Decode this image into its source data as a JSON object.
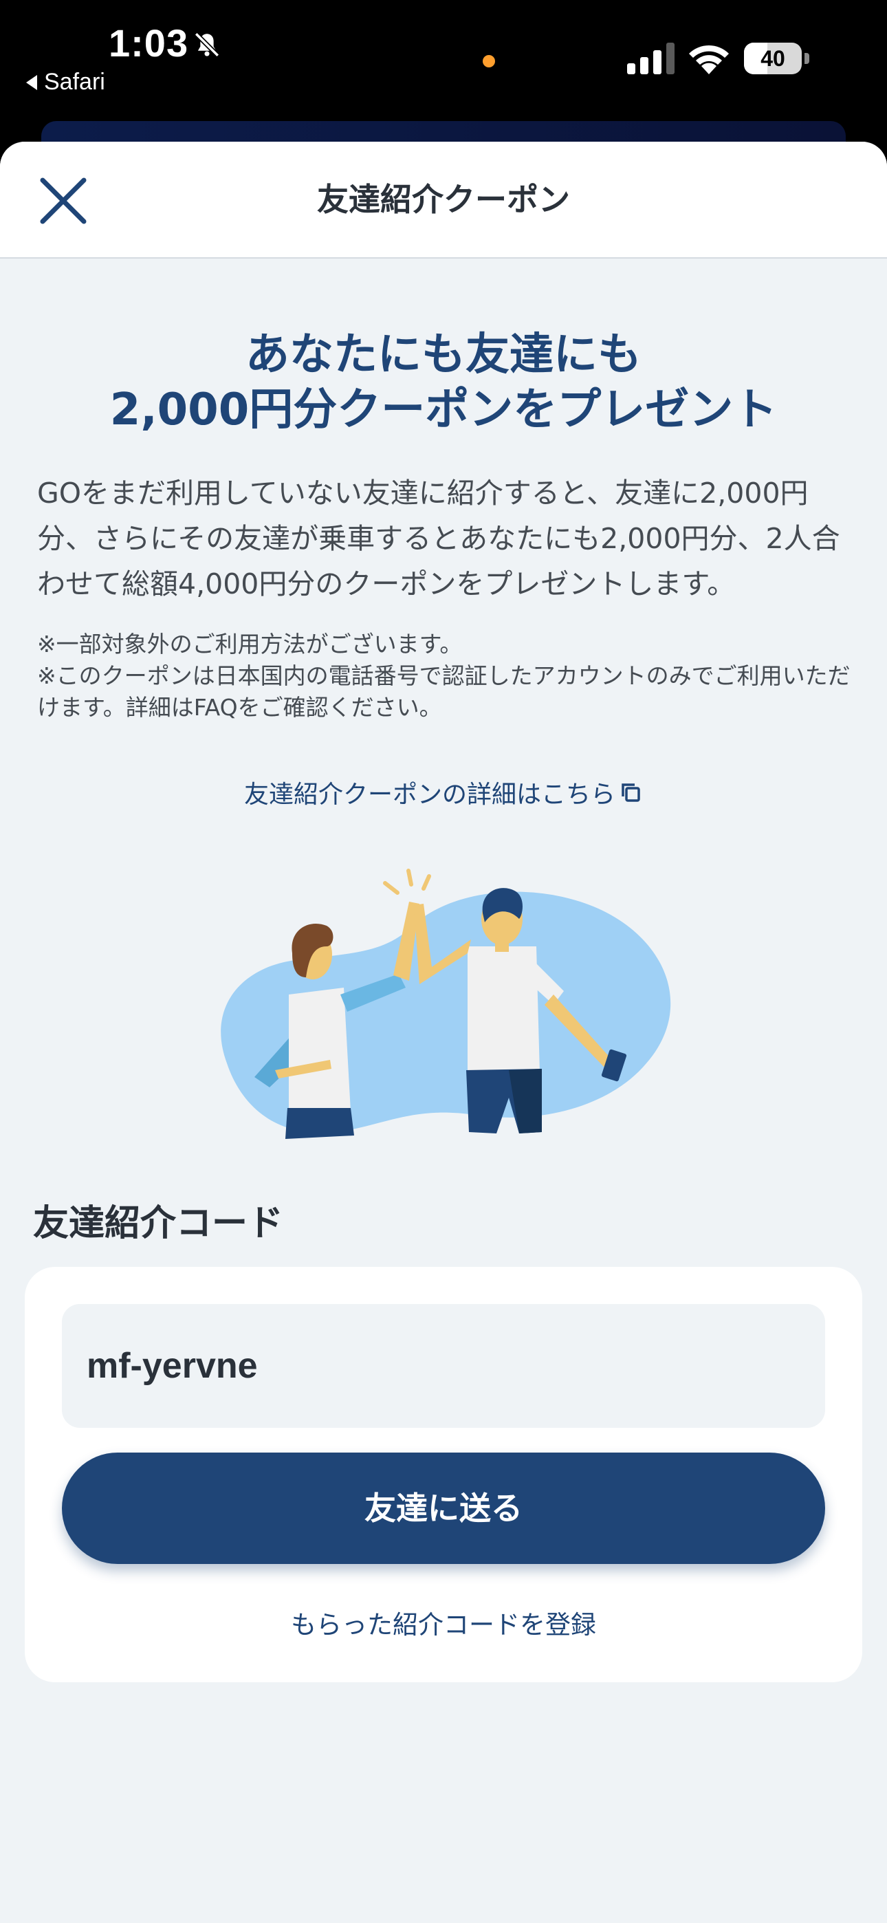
{
  "status_bar": {
    "time": "1:03",
    "back_app": "Safari",
    "battery": "40",
    "battery_level": 0.4
  },
  "header": {
    "title": "友達紹介クーポン"
  },
  "hero": {
    "headline_line1": "あなたにも友達にも",
    "headline_line2": "2,000円分クーポンをプレゼント",
    "description": "GOをまだ利用していない友達に紹介すると、友達に2,000円分、さらにその友達が乗車するとあなたにも2,000円分、2人合わせて総額4,000円分のクーポンをプレゼントします。",
    "note1": "※一部対象外のご利用方法がございます。",
    "note2": "※このクーポンは日本国内の電話番号で認証したアカウントのみでご利用いただけます。詳細はFAQをご確認ください。",
    "detail_link": "友達紹介クーポンの詳細はこちら"
  },
  "referral": {
    "heading": "友達紹介コード",
    "code": "mf-yervne",
    "send_button": "友達に送る",
    "register_link": "もらった紹介コードを登録"
  },
  "colors": {
    "brand_navy": "#1f4577",
    "sheet_bg": "#eff3f6",
    "illustration_blue": "#9fd0f5"
  }
}
